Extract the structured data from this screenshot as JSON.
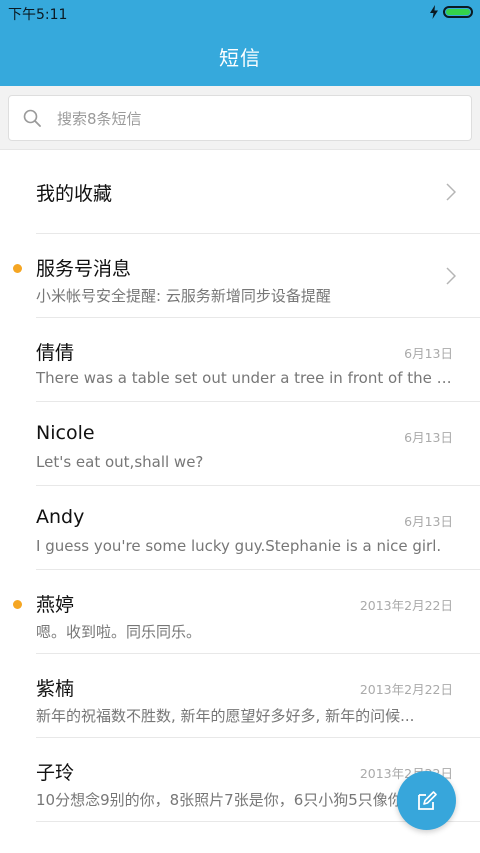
{
  "status_bar": {
    "time": "下午5:11",
    "battery_color": "#34d24a"
  },
  "header": {
    "title": "短信",
    "background": "#36a9dc"
  },
  "search": {
    "placeholder": "搜索8条短信",
    "icon": "search-icon"
  },
  "conversations": [
    {
      "name": "我的收藏",
      "snippet": "",
      "date": "",
      "unread": false,
      "chevron": true
    },
    {
      "name": "服务号消息",
      "snippet": "小米帐号安全提醒: 云服务新增同步设备提醒",
      "date": "",
      "unread": true,
      "chevron": true
    },
    {
      "name": "倩倩",
      "snippet": "There was a table set out under a tree in front of the house...",
      "date": "6月13日",
      "unread": false,
      "chevron": false
    },
    {
      "name": "Nicole",
      "snippet": "Let's eat out,shall we?",
      "date": "6月13日",
      "unread": false,
      "chevron": false
    },
    {
      "name": "Andy",
      "snippet": "I guess you're some lucky guy.Stephanie is a nice girl.",
      "date": "6月13日",
      "unread": false,
      "chevron": false
    },
    {
      "name": "燕婷",
      "snippet": "嗯。收到啦。同乐同乐。",
      "date": "2013年2月22日",
      "unread": true,
      "chevron": false
    },
    {
      "name": "紫楠",
      "snippet": "新年的祝福数不胜数, 新年的愿望好多好多, 新年的问候...",
      "date": "2013年2月22日",
      "unread": false,
      "chevron": false
    },
    {
      "name": "子玲",
      "snippet": "10分想念9别的你，8张照片7张是你，6只小狗5只像你...",
      "date": "2013年2月22日",
      "unread": false,
      "chevron": false
    }
  ],
  "fab": {
    "icon": "compose-icon",
    "color": "#37a6db"
  },
  "colors": {
    "unread_dot": "#f5a623"
  }
}
